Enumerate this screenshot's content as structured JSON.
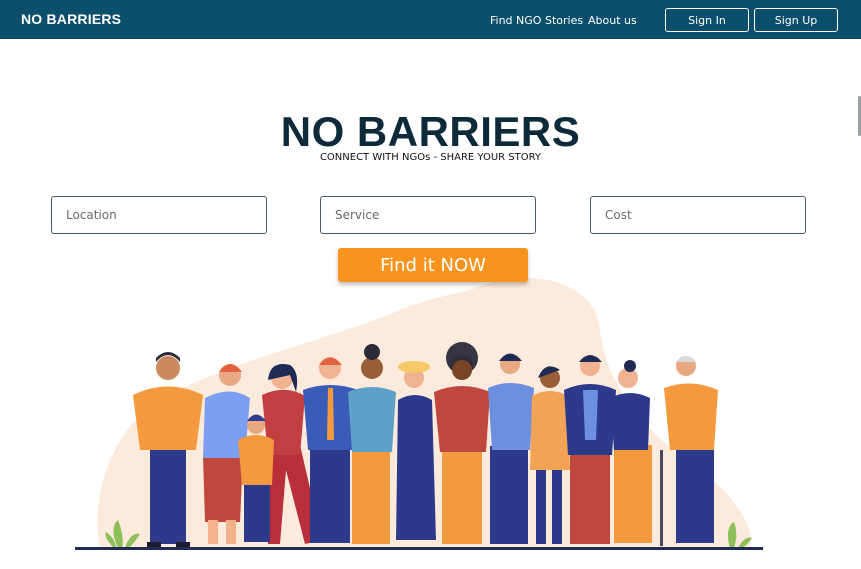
{
  "navbar": {
    "brand": "NO BARRIERS",
    "links": [
      "Find NGO",
      "Stories",
      "About us"
    ],
    "sign_in": "Sign In",
    "sign_up": "Sign Up"
  },
  "hero": {
    "title": "NO BARRIERS",
    "subtitle": "CONNECT WITH NGOs - SHARE YOUR STORY"
  },
  "search": {
    "location_placeholder": "Location",
    "service_placeholder": "Service",
    "cost_placeholder": "Cost",
    "submit_label": "Find it NOW"
  },
  "colors": {
    "navbar": "#0b4f6c",
    "cta": "#f7941d",
    "title": "#0c2a3a",
    "blob": "#fcebdc"
  }
}
